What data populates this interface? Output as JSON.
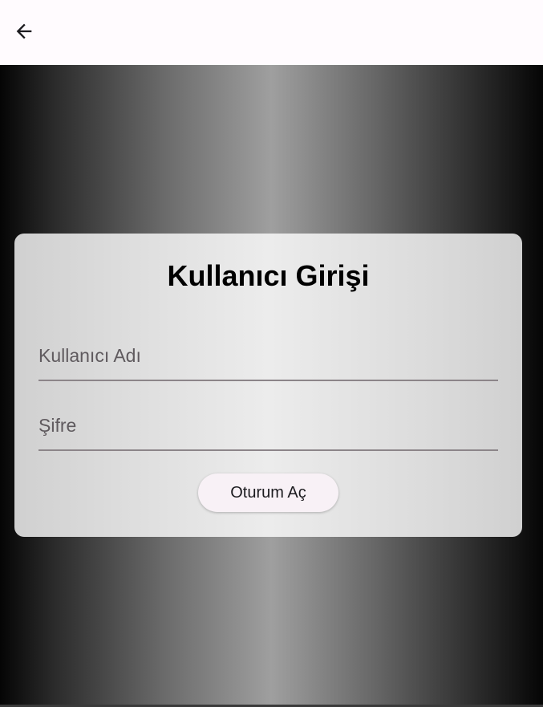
{
  "app_bar": {
    "back_icon": "arrow-left-icon"
  },
  "login_card": {
    "title": "Kullanıcı Girişi",
    "username_placeholder": "Kullanıcı Adı",
    "password_placeholder": "Şifre",
    "submit_label": "Oturum Aç"
  },
  "colors": {
    "app_bar_bg": "#fffbfe",
    "button_bg": "#f8f1f6",
    "underline": "#8c8589"
  }
}
